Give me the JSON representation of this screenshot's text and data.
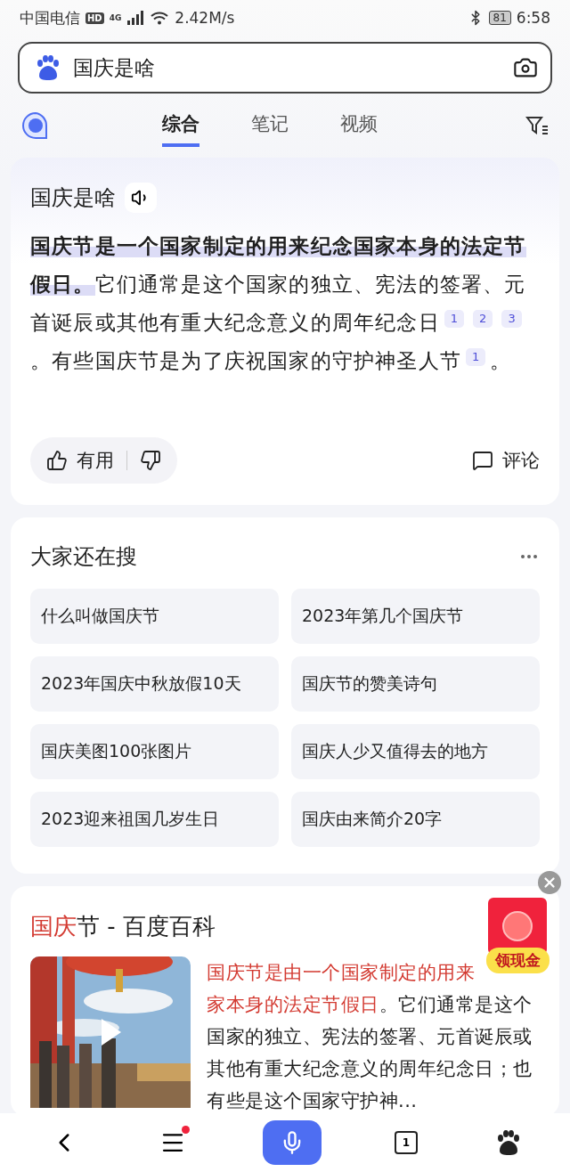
{
  "status_bar": {
    "carrier": "中国电信",
    "hd": "HD",
    "network": "4G",
    "speed": "2.42M/s",
    "battery": "81",
    "time": "6:58"
  },
  "search": {
    "value": "国庆是啥"
  },
  "tabs": [
    {
      "label": "综合",
      "selected": true
    },
    {
      "label": "笔记",
      "selected": false
    },
    {
      "label": "视频",
      "selected": false
    }
  ],
  "ai_answer": {
    "title": "国庆是啥",
    "body": [
      {
        "kind": "highlight",
        "text": "国庆节是一个国家制定的用来纪念国家本身的法定节假日。"
      },
      {
        "kind": "text",
        "text": "它们通常是这个国家的独立、宪法的签署、元首诞辰或其他有重大纪念意义的周年纪念日"
      },
      {
        "kind": "cite",
        "text": "1"
      },
      {
        "kind": "cite",
        "text": "2"
      },
      {
        "kind": "cite",
        "text": "3"
      },
      {
        "kind": "text",
        "text": "。有些国庆节是为了庆祝国家的守护神圣人节"
      },
      {
        "kind": "cite",
        "text": "1"
      },
      {
        "kind": "text",
        "text": "。"
      }
    ],
    "useful": "有用",
    "comment": "评论"
  },
  "related": {
    "title": "大家还在搜",
    "items": [
      "什么叫做国庆节",
      "2023年第几个国庆节",
      "2023年国庆中秋放假10天",
      "国庆节的赞美诗句",
      "国庆美图100张图片",
      "国庆人少又值得去的地方",
      "2023迎来祖国几岁生日",
      "国庆由来简介20字"
    ]
  },
  "baike": {
    "title_highlight": "国庆",
    "title_rest": "节 - 百度百科",
    "summary_first_line": "国庆节是由一个国家制定的用来",
    "summary_highlight": "家本身的法定节假日",
    "summary_rest": "。它们通常是这个国家的独立、宪法的签署、元首诞辰或其他有重大纪念意义的周年纪念日；也有些是这个国家守护神..."
  },
  "promo": {
    "label": "领现金"
  },
  "bottom_nav": {
    "tab_count": "1",
    "menu_badge": true
  }
}
